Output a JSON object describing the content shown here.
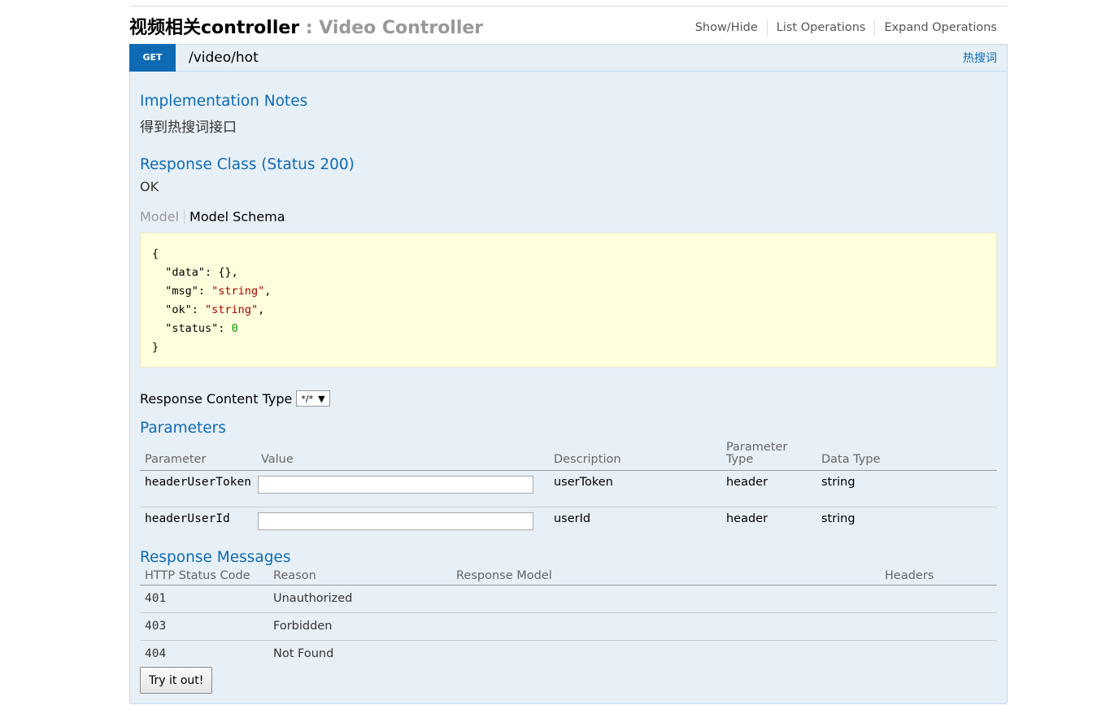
{
  "resource": {
    "title": "视频相关controller",
    "separator": " : ",
    "description": "Video Controller",
    "actions": [
      "Show/Hide",
      "List Operations",
      "Expand Operations"
    ]
  },
  "operation": {
    "method": "GET",
    "path": "/video/hot",
    "summary": "热搜词"
  },
  "implementation_notes": {
    "title": "Implementation Notes",
    "text": "得到热搜词接口"
  },
  "response_class": {
    "title": "Response Class (Status 200)",
    "text": "OK",
    "tab_model": "Model",
    "tab_schema": "Model Schema",
    "schema_open": "{",
    "schema_close": "}",
    "fields": [
      {
        "key": "\"data\"",
        "value": "{}",
        "type": "obj",
        "comma": ","
      },
      {
        "key": "\"msg\"",
        "value": "\"string\"",
        "type": "str",
        "comma": ","
      },
      {
        "key": "\"ok\"",
        "value": "\"string\"",
        "type": "str",
        "comma": ","
      },
      {
        "key": "\"status\"",
        "value": "0",
        "type": "num",
        "comma": ""
      }
    ]
  },
  "content_type": {
    "label": "Response Content Type",
    "selected": "*/*"
  },
  "parameters": {
    "title": "Parameters",
    "headers": [
      "Parameter",
      "Value",
      "Description",
      "Parameter Type",
      "Data Type"
    ],
    "rows": [
      {
        "name": "headerUserToken",
        "value": "",
        "description": "userToken",
        "param_type": "header",
        "data_type": "string"
      },
      {
        "name": "headerUserId",
        "value": "",
        "description": "userId",
        "param_type": "header",
        "data_type": "string"
      }
    ]
  },
  "response_messages": {
    "title": "Response Messages",
    "headers": [
      "HTTP Status Code",
      "Reason",
      "Response Model",
      "Headers"
    ],
    "rows": [
      {
        "code": "401",
        "reason": "Unauthorized",
        "model": "",
        "headers": ""
      },
      {
        "code": "403",
        "reason": "Forbidden",
        "model": "",
        "headers": ""
      },
      {
        "code": "404",
        "reason": "Not Found",
        "model": "",
        "headers": ""
      }
    ]
  },
  "try_button": "Try it out!"
}
